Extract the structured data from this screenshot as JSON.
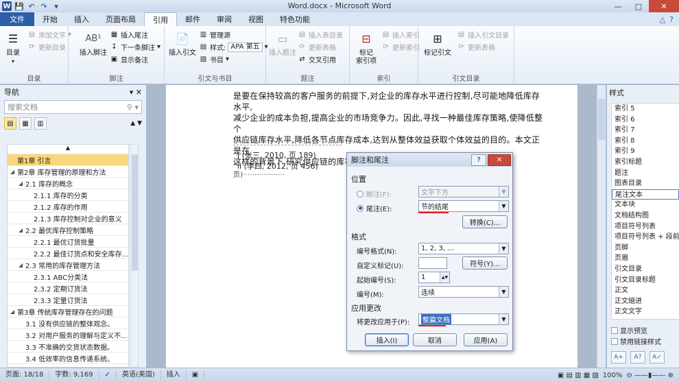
{
  "window": {
    "title": "Word.docx - Microsoft Word",
    "buttons": [
      "—",
      "□",
      "✕"
    ]
  },
  "qat": {
    "logo": "W",
    "save": "💾",
    "undo": "↶",
    "redo": "↷",
    "more": "▾"
  },
  "tabs": [
    {
      "label": "文件"
    },
    {
      "label": "开始"
    },
    {
      "label": "插入"
    },
    {
      "label": "页面布局"
    },
    {
      "label": "引用"
    },
    {
      "label": "邮件"
    },
    {
      "label": "审阅"
    },
    {
      "label": "视图"
    },
    {
      "label": "特色功能"
    }
  ],
  "ribbon": {
    "toc": {
      "label": "目录",
      "add_text": "添加文字",
      "update": "更新目录",
      "group": "目录"
    },
    "footnote": {
      "insert": "插入脚注",
      "insert_endnote": "插入尾注",
      "next": "下一条脚注",
      "show": "显示备注",
      "group": "脚注",
      "ab": "AB¹"
    },
    "citation": {
      "insert": "插入引文",
      "manage": "管理源",
      "style_label": "样式:",
      "style_value": "APA 第五",
      "biblio": "书目",
      "group": "引文与书目"
    },
    "caption": {
      "insert": "插入题注",
      "insert_table": "插入表目录",
      "update_table": "更新表格",
      "cross_ref": "交叉引用",
      "group": "题注"
    },
    "index": {
      "mark": "标记\n索引项",
      "insert": "插入索引",
      "update": "更新索引",
      "group": "索引"
    },
    "toa": {
      "mark": "标记引文",
      "insert": "插入引文目录",
      "update": "更新表格",
      "group": "引文目录"
    }
  },
  "nav": {
    "title": "导航",
    "search_placeholder": "搜索文档",
    "items": [
      {
        "label": "第1章 引言",
        "level": 0,
        "selected": true,
        "arrow": ""
      },
      {
        "label": "第2章 库存管理的原理和方法",
        "level": 0,
        "selected": false,
        "arrow": "◢"
      },
      {
        "label": "2.1 库存的概念",
        "level": 1,
        "selected": false,
        "arrow": "◢"
      },
      {
        "label": "2.1.1 库存的分类",
        "level": 2,
        "selected": false,
        "arrow": ""
      },
      {
        "label": "2.1.2 库存的作用",
        "level": 2,
        "selected": false,
        "arrow": ""
      },
      {
        "label": "2.1.3 库存控制对企业的意义",
        "level": 2,
        "selected": false,
        "arrow": ""
      },
      {
        "label": "2.2 最优库存控制策略",
        "level": 1,
        "selected": false,
        "arrow": "◢"
      },
      {
        "label": "2.2.1 最优订货批量",
        "level": 2,
        "selected": false,
        "arrow": ""
      },
      {
        "label": "2.2.2 最佳订货点和安全库存...",
        "level": 2,
        "selected": false,
        "arrow": ""
      },
      {
        "label": "2.3 常用的库存管理方法",
        "level": 1,
        "selected": false,
        "arrow": "◢"
      },
      {
        "label": "2.3.1 ABC分类法",
        "level": 2,
        "selected": false,
        "arrow": ""
      },
      {
        "label": "2.3.2 定期订货法",
        "level": 2,
        "selected": false,
        "arrow": ""
      },
      {
        "label": "2.3.3 定量订货法",
        "level": 2,
        "selected": false,
        "arrow": ""
      },
      {
        "label": "第3章 传统库存管理存在的问题",
        "level": 0,
        "selected": false,
        "arrow": "◢"
      },
      {
        "label": "3.1 没有供应链的整体观念。",
        "level": 1,
        "selected": false,
        "arrow": ""
      },
      {
        "label": "3.2 对用户服务的理解与定义不...",
        "level": 1,
        "selected": false,
        "arrow": ""
      },
      {
        "label": "3.3 不准确的交货状态数据。",
        "level": 1,
        "selected": false,
        "arrow": ""
      },
      {
        "label": "3.4 低效率的信息传递系统。",
        "level": 1,
        "selected": false,
        "arrow": ""
      }
    ]
  },
  "document": {
    "lines": [
      "是要在保持较高的客户服务的前提下,对企业的库存水平进行控制,尽可能地降低库存水平,",
      "减少企业的成本负担,提高企业的市场竞争力。因此,寻找一种最佳库存策略,使降低整个",
      "供应链库存水平,降低各节点库存成本,达到从整体效益获取个体效益的目的。本文正是在",
      "这样的背景下,研究供应链的库存控制策略问题。"
    ],
    "section_break": "分节符(下一页)",
    "notes": [
      "i (张三, 2010, 页 189)",
      "ii (李四, 2012, 页 456)"
    ]
  },
  "styles": {
    "title": "样式",
    "items": [
      "索引 5",
      "索引 6",
      "索引 7",
      "索引 8",
      "索引 9",
      "索引标题",
      "题注",
      "图表目录",
      "尾注文本",
      "文本块",
      "文档结构图",
      "项目符号列表",
      "项目符号列表 + 段前",
      "页脚",
      "页眉",
      "引文目录",
      "引文目录标题",
      "正文",
      "正文缩进",
      "正文文字"
    ],
    "selected": "尾注文本",
    "show_preview": "显示预览",
    "disable_linked": "禁用链接样式"
  },
  "status": {
    "page": "页面: 18/18",
    "words": "字数: 9,169",
    "lang": "英语(美国)",
    "mode": "插入",
    "zoom": "100%"
  },
  "dialog": {
    "title": "脚注和尾注",
    "help": "?",
    "location_section": "位置",
    "footnote_label": "脚注(F):",
    "footnote_value": "文字下方",
    "endnote_label": "尾注(E):",
    "endnote_value": "节的结尾",
    "convert": "转换(C)...",
    "format_section": "格式",
    "number_format_label": "编号格式(N):",
    "number_format_value": "1, 2, 3, …",
    "custom_mark_label": "自定义标记(U):",
    "symbol": "符号(Y)...",
    "start_at_label": "起始编号(S):",
    "start_at_value": "1",
    "numbering_label": "编号(M):",
    "numbering_value": "连续",
    "apply_section": "应用更改",
    "apply_to_label": "将更改应用于(P):",
    "apply_to_value": "整篇文档",
    "insert": "插入(I)",
    "cancel": "取消",
    "apply": "应用(A)"
  },
  "colors": {
    "accent": "#2c5fa8",
    "highlight": "#fbd77b",
    "red": "#e02020"
  }
}
